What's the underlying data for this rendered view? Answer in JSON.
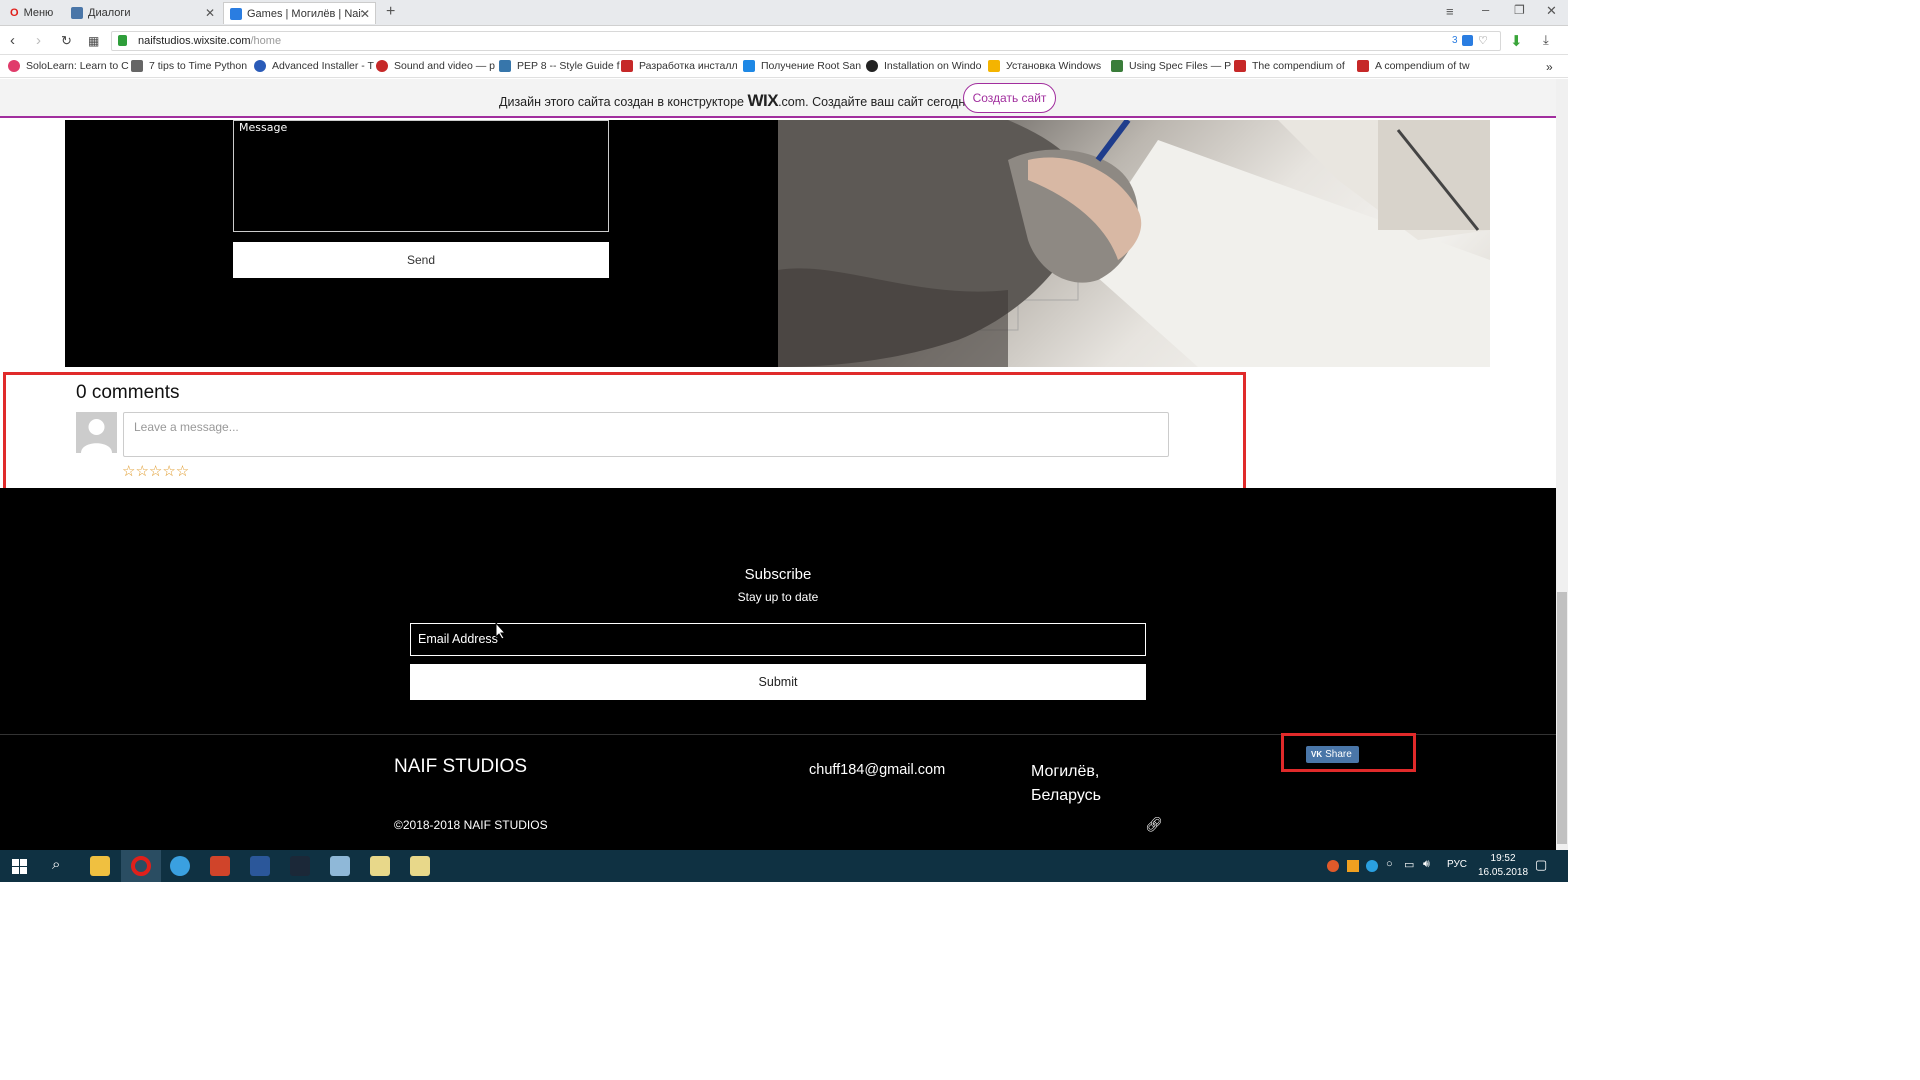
{
  "browser": {
    "tabs": [
      {
        "label": "Меню"
      },
      {
        "label": "Диалоги"
      },
      {
        "label": "Games | Могилёв | Naif St"
      }
    ],
    "url_host": "naifstudios.wixsite.com",
    "url_path": "/home",
    "url_badge": "3",
    "bookmarks": [
      {
        "label": "SoloLearn: Learn to C"
      },
      {
        "label": "7 tips to Time Python"
      },
      {
        "label": "Advanced Installer - T"
      },
      {
        "label": "Sound and video — p"
      },
      {
        "label": "PEP 8 -- Style Guide f"
      },
      {
        "label": "Разработка инсталл"
      },
      {
        "label": "Получение Root San"
      },
      {
        "label": "Installation on Windo"
      },
      {
        "label": "Установка Windows"
      },
      {
        "label": "Using Spec Files — P"
      },
      {
        "label": "The compendium of"
      },
      {
        "label": "A compendium of tw"
      }
    ]
  },
  "wix_banner": {
    "text_before": "Дизайн этого сайта создан в конструкторе",
    "wix_logo": "WIX",
    "text_after": ".com. Создайте ваш сайт сегодня.",
    "button": "Создать сайт"
  },
  "contact": {
    "message_placeholder": "Message",
    "send_label": "Send"
  },
  "comments": {
    "title": "0 comments",
    "input_placeholder": "Leave a message...",
    "stars": "☆☆☆☆☆"
  },
  "footer": {
    "subscribe_title": "Subscribe",
    "subscribe_subtitle": "Stay up to date",
    "email_placeholder": "Email Address",
    "submit_label": "Submit",
    "brand": "NAIF STUDIOS",
    "email": "chuff184@gmail.com",
    "city": "Могилёв, Беларусь",
    "copyright": "©2018-2018 NAIF STUDIOS",
    "share_label": "Share"
  },
  "taskbar": {
    "lang": "РУС",
    "time": "19:52",
    "date": "16.05.2018"
  }
}
